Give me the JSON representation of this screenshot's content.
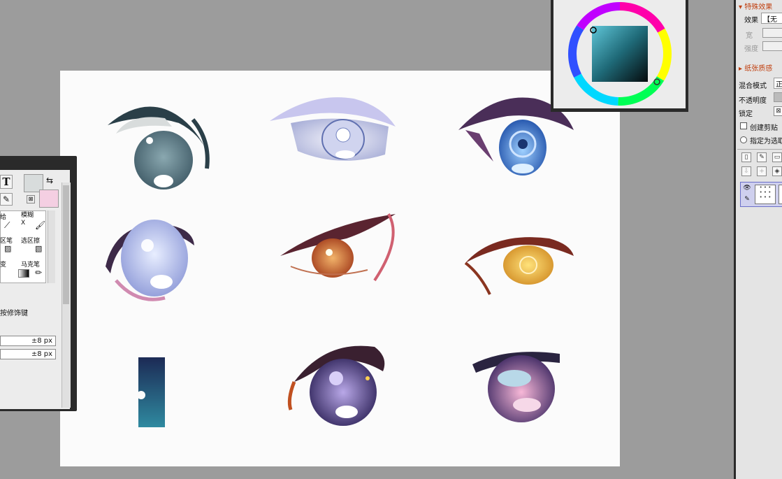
{
  "tool_panel": {
    "text_tool_glyph": "T",
    "tools": [
      {
        "label": "给",
        "icon": "blur-brush-icon"
      },
      {
        "label": "模糊\nX",
        "icon": "blur-tool-icon"
      },
      {
        "label": "区笔",
        "icon": "selection-pen-icon"
      },
      {
        "label": "选区擦",
        "icon": "selection-eraser-icon"
      },
      {
        "label": "变",
        "icon": "gradient-icon"
      },
      {
        "label": "马克笔",
        "icon": "marker-pen-icon"
      }
    ],
    "modifier_text": "按修饰键",
    "field1_value": "±8 px",
    "field2_value": "±8 px",
    "primary_color": "#d8dcdc",
    "secondary_color": "#f4cfe2"
  },
  "right_panel": {
    "special_effects_title": "特殊效果",
    "effect_label": "效果",
    "effect_value": "【无",
    "width_label": "宽",
    "strength_label": "强度",
    "paper_texture_title": "纸张质感",
    "blend_mode_label": "混合模式",
    "blend_mode_value": "正",
    "opacity_label": "不透明度",
    "lock_label": "锁定",
    "clipping_label": "创建剪贴",
    "selection_source_label": "指定为选取"
  }
}
